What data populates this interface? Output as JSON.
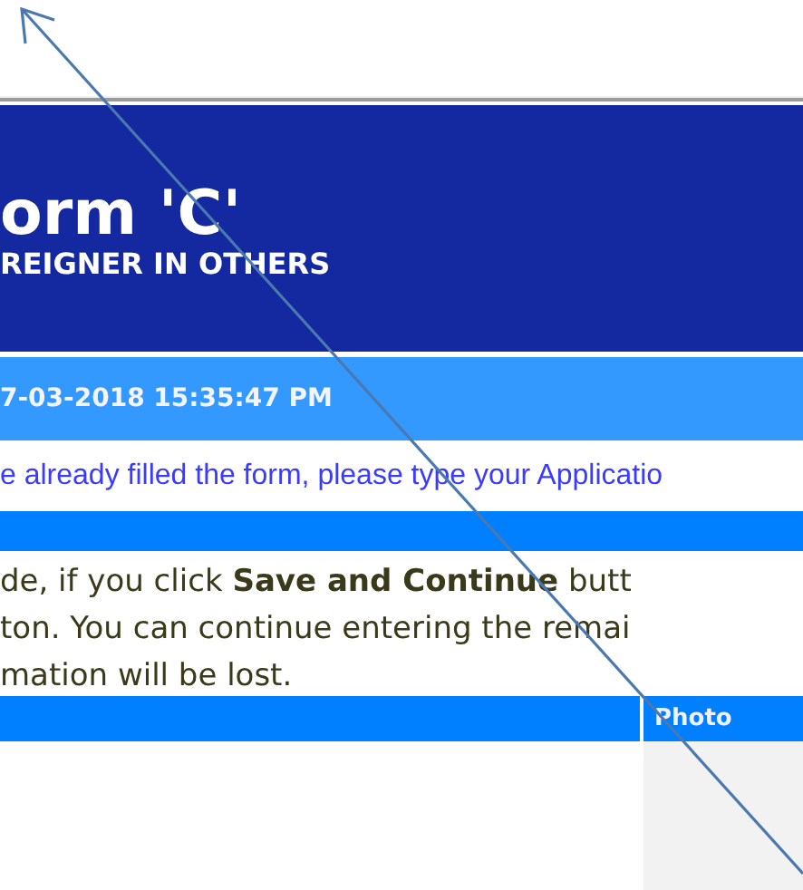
{
  "header": {
    "title": "orm 'C'",
    "subtitle": "REIGNER IN OTHERS"
  },
  "date_bar": {
    "text": "7-03-2018 15:35:47 PM"
  },
  "notice": {
    "text": "e already filled the form, please type your Applicatio"
  },
  "instructions": {
    "text": "de, if you click **Save and Continue** butt\nton. You can continue entering the remai\nmation will be lost."
  },
  "table": {
    "photo_column": {
      "label": "Photo"
    }
  },
  "annotation": {
    "kind": "arrow"
  }
}
